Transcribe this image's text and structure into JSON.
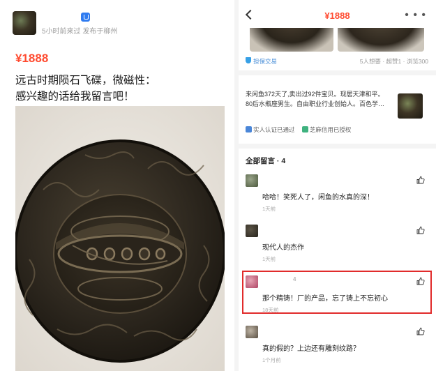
{
  "left": {
    "meta": "5小时前来过 发布于柳州",
    "price": "¥1888",
    "title_lines": [
      "远古时期陨石飞碟，微磁性：",
      "感兴趣的话给我留言吧！"
    ]
  },
  "right": {
    "header_price": "¥1888",
    "trade_label": "担保交易",
    "stats": "5人想要 · 超赞1 · 浏览300",
    "seller_desc_lines": [
      "来闲鱼372天了,卖出过92件宝贝。现居天津和平。",
      "80后水瓶座男生。自由职业行业创始人。百色学…"
    ],
    "verify_real": "实人认证已通过",
    "verify_zhima": "芝麻信用已授权",
    "comments_title": "全部留言 · 4",
    "comments": [
      {
        "name": "",
        "text": "哈哈！笑死人了，闲鱼的水真的深！",
        "time": "1天前"
      },
      {
        "name": "",
        "text": "现代人的杰作",
        "time": "1天前"
      },
      {
        "name": "4",
        "text": "那个精铸！厂的产品，忘了铸上不忘初心",
        "time": "18天前"
      },
      {
        "name": "",
        "text": "真的假的？上边还有雕刻纹路？",
        "time": "1个月前"
      }
    ]
  }
}
